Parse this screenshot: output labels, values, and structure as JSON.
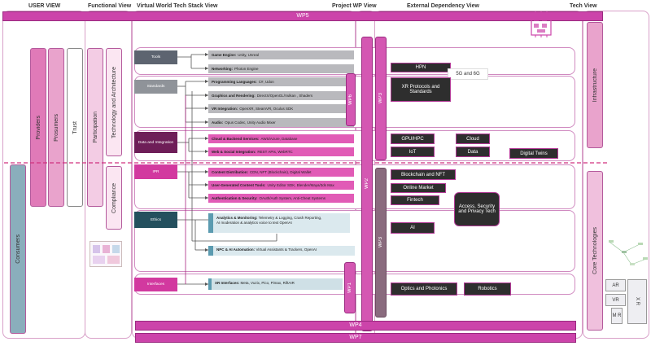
{
  "headers": {
    "user_view": "USER VIEW",
    "functional_view": "Functional View",
    "virtual_world": "Virtual World Tech Stack View",
    "project_wp": "Project WP View",
    "external_dep": "External Dependency View",
    "tech_view": "Tech View"
  },
  "wp_bars": {
    "wp5": "WP5",
    "wp4": "WP4",
    "wp7": "WP7"
  },
  "user_view": {
    "providers": "Providers",
    "prosumers": "Prosumers",
    "trust": "Trust",
    "consumers": "Consumers"
  },
  "functional_view": {
    "participation": "Participation",
    "tech_arch": "Technology and Architecture",
    "compliance": "Compliance"
  },
  "stack": {
    "left_boxes": {
      "tools": "Tools",
      "standards": "Standards",
      "data": "Data and Integration",
      "ipr": "IPR",
      "ethics": "Ethics",
      "interfaces": "Interfaces"
    },
    "rows": {
      "game_engine": {
        "title": "Game Engine:",
        "text": "Unity, Unreal"
      },
      "networking": {
        "title": "Networking:",
        "text": "Photon Engine"
      },
      "programming": {
        "title": "Programming Languages:",
        "text": "C#, Udon"
      },
      "graphics": {
        "title": "Graphics and Rendering:",
        "text": "DirectX/OpenGL/Vulkan , Shaders"
      },
      "vr_integration": {
        "title": "VR Integration:",
        "text": "OpenXR, SteamVR, Oculus SDK"
      },
      "audio": {
        "title": "Audio:",
        "text": "Opus Codec, Unity Audio Mixer"
      },
      "cloud_backend": {
        "title": "Cloud & Backend Services:",
        "text": "AWS/Azure, Database"
      },
      "web_social": {
        "title": "Web & Social Integration:",
        "text": "REST APIs, WebRTC"
      },
      "content_dist": {
        "title": "Content Distribution:",
        "text": "CDN, NFT (Blockchain), Digital Wallet"
      },
      "ugc_tools": {
        "title": "User-Generated Content Tools:",
        "text": "Unity Editor SDK, Blender/Maya/3ds Max"
      },
      "auth_security": {
        "title": "Authentication & Security:",
        "text": "OAuth/Auth System, Anti-Cheat Systems"
      },
      "analytics": {
        "title": "Analytics & Monitoring:",
        "text": "Telemetry & Logging, Crash Reporting,",
        "text2": "AI moderation & analytics voice to text   OpenAI"
      },
      "npc_ai": {
        "title": "NPC & AI Automation:",
        "text": "Virtual Assistants & Trackers, OpenAI"
      },
      "xr_interfaces": {
        "title": "XR Interfaces:",
        "text": "Meta, Vuzix, Pico, Pimax, RiftAIR"
      }
    }
  },
  "wp_labels": {
    "wp6": "WP6",
    "wp3_a": "WP3",
    "wp2": "WP2",
    "wp3_b": "WP3",
    "wp1": "WP1"
  },
  "dependencies": {
    "hpn": "HPN",
    "five_g": "5G and 6G",
    "xr_protocols": "XR Protocols and Standards",
    "gpu_hpc": "GPU/HPC",
    "cloud": "Cloud",
    "iot": "IoT",
    "data": "Data",
    "digital_twins": "Digital Twins",
    "blockchain": "Blockchain and  NFT",
    "online_market": "Online Market",
    "fintech": "Fintech",
    "access_security": "Access, Security and Privacy Tech",
    "ai": "AI",
    "optics": "Optics and Photonics",
    "robotics": "Robotics"
  },
  "tech_view": {
    "infrastructure": "Infrastructure",
    "core_tech": "Core Technologies",
    "ar": "AR",
    "vr": "VR",
    "mr": "M R",
    "xr": "X R"
  },
  "colors": {
    "wp_magenta": "#cc44aa",
    "pink_row": "#e15bb6",
    "gray_row": "#b9b9bd",
    "teal": "#5b9bb0",
    "dark_box": "#2e2e2e",
    "dashed_line": "#d0307f"
  }
}
